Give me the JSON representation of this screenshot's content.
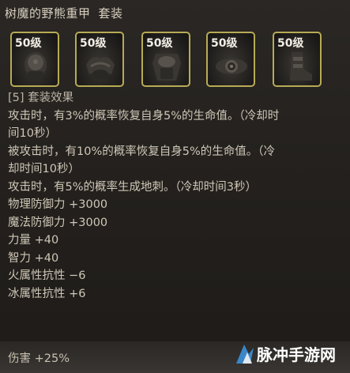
{
  "header": {
    "set_name": "树魔的野熊重甲",
    "set_tag": "套装"
  },
  "slots": [
    {
      "level": "50级",
      "icon": "helmet-icon"
    },
    {
      "level": "50级",
      "icon": "shoulder-armor-icon"
    },
    {
      "level": "50级",
      "icon": "chest-armor-icon"
    },
    {
      "level": "50级",
      "icon": "belt-icon"
    },
    {
      "level": "50级",
      "icon": "boots-icon"
    }
  ],
  "effects": {
    "header": "[5] 套装效果",
    "lines": [
      "攻击时，有3%的概率恢复自身5%的生命值。（冷却时",
      "间10秒）",
      "被攻击时，有10%的概率恢复自身5%的生命值。（冷",
      "却时间10秒）",
      "攻击时，有5%的概率生成地刺。（冷却时间3秒）",
      "物理防御力 +3000",
      "魔法防御力 +3000",
      "力量 +40",
      "智力 +40",
      "火属性抗性 −6",
      "冰属性抗性 +6"
    ]
  },
  "bottom": {
    "damage": "伤害 +25%"
  },
  "watermark": {
    "text": "脉冲手游网"
  },
  "colors": {
    "slot_border": "#b7ab55",
    "text": "#cfc7b7",
    "background": "#23201d"
  }
}
